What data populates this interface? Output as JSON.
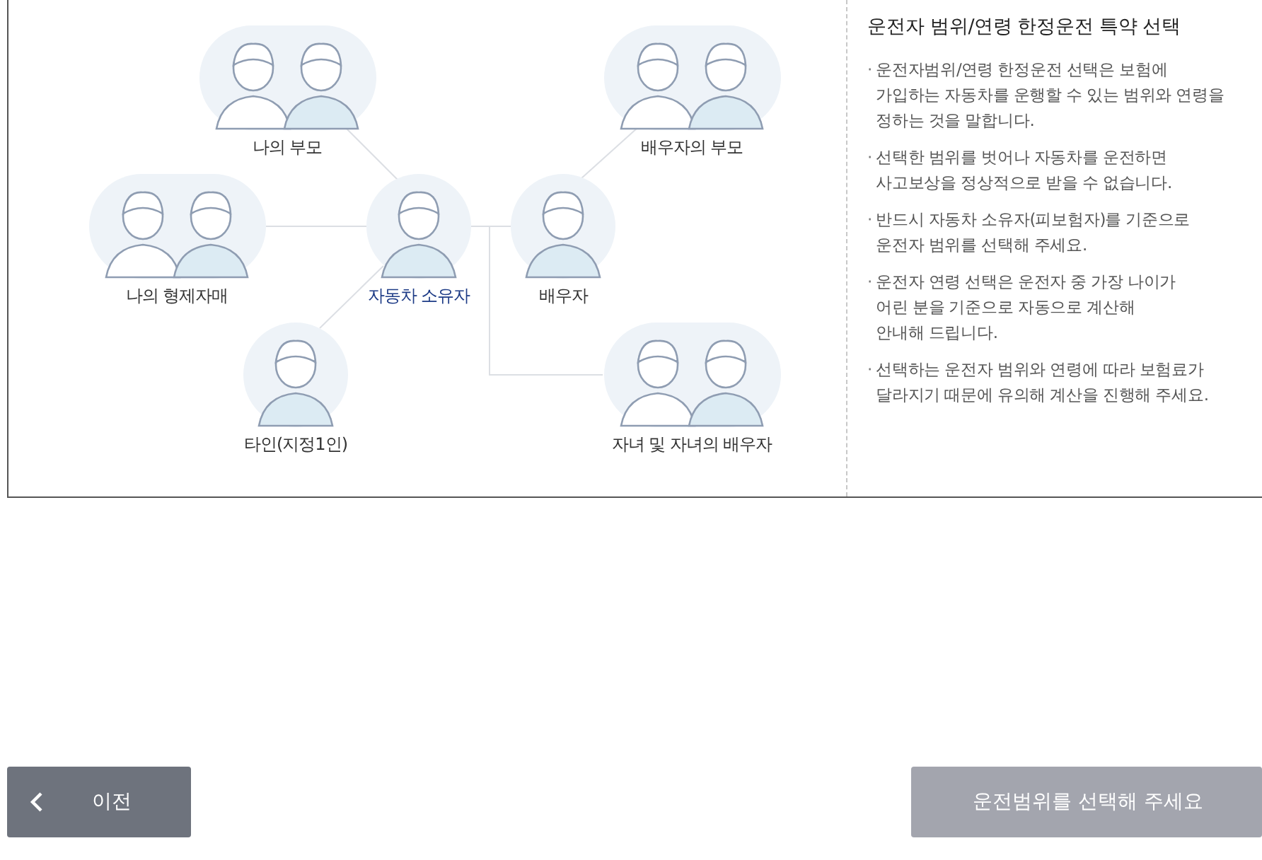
{
  "diagram": {
    "nodes": [
      {
        "label": "나의 부모",
        "kind": "pair",
        "selected": false
      },
      {
        "label": "배우자의 부모",
        "kind": "pair",
        "selected": false
      },
      {
        "label": "나의 형제자매",
        "kind": "pair",
        "selected": false
      },
      {
        "label": "자동차 소유자",
        "kind": "single",
        "selected": true
      },
      {
        "label": "배우자",
        "kind": "single",
        "selected": false
      },
      {
        "label": "타인(지정1인)",
        "kind": "single",
        "selected": false
      },
      {
        "label": "자녀 및 자녀의 배우자",
        "kind": "pair",
        "selected": false
      }
    ]
  },
  "info": {
    "title": "운전자 범위/연령 한정운전 특약 선택",
    "items": [
      {
        "mark": "·",
        "text": "운전자범위/연령 한정운전 선택은 보험에\n가입하는 자동차를 운행할 수 있는 범위와 연령을\n정하는 것을 말합니다."
      },
      {
        "mark": "·",
        "text": "선택한 범위를 벗어나 자동차를 운전하면\n사고보상을 정상적으로 받을 수 없습니다."
      },
      {
        "mark": "·",
        "text": "반드시 자동차 소유자(피보험자)를 기준으로\n운전자 범위를 선택해 주세요."
      },
      {
        "mark": "·",
        "text": "운전자 연령 선택은 운전자 중 가장 나이가\n어린 분을 기준으로 자동으로 계산해\n안내해 드립니다."
      },
      {
        "mark": "·",
        "text": "선택하는 운전자 범위와 연령에 따라 보험료가\n달라지기 때문에 유의해 계산을 진행해 주세요."
      }
    ]
  },
  "buttons": {
    "prev": {
      "label": "이전",
      "disabled": false
    },
    "next": {
      "label": "운전범위를 선택해 주세요",
      "disabled": true
    }
  }
}
